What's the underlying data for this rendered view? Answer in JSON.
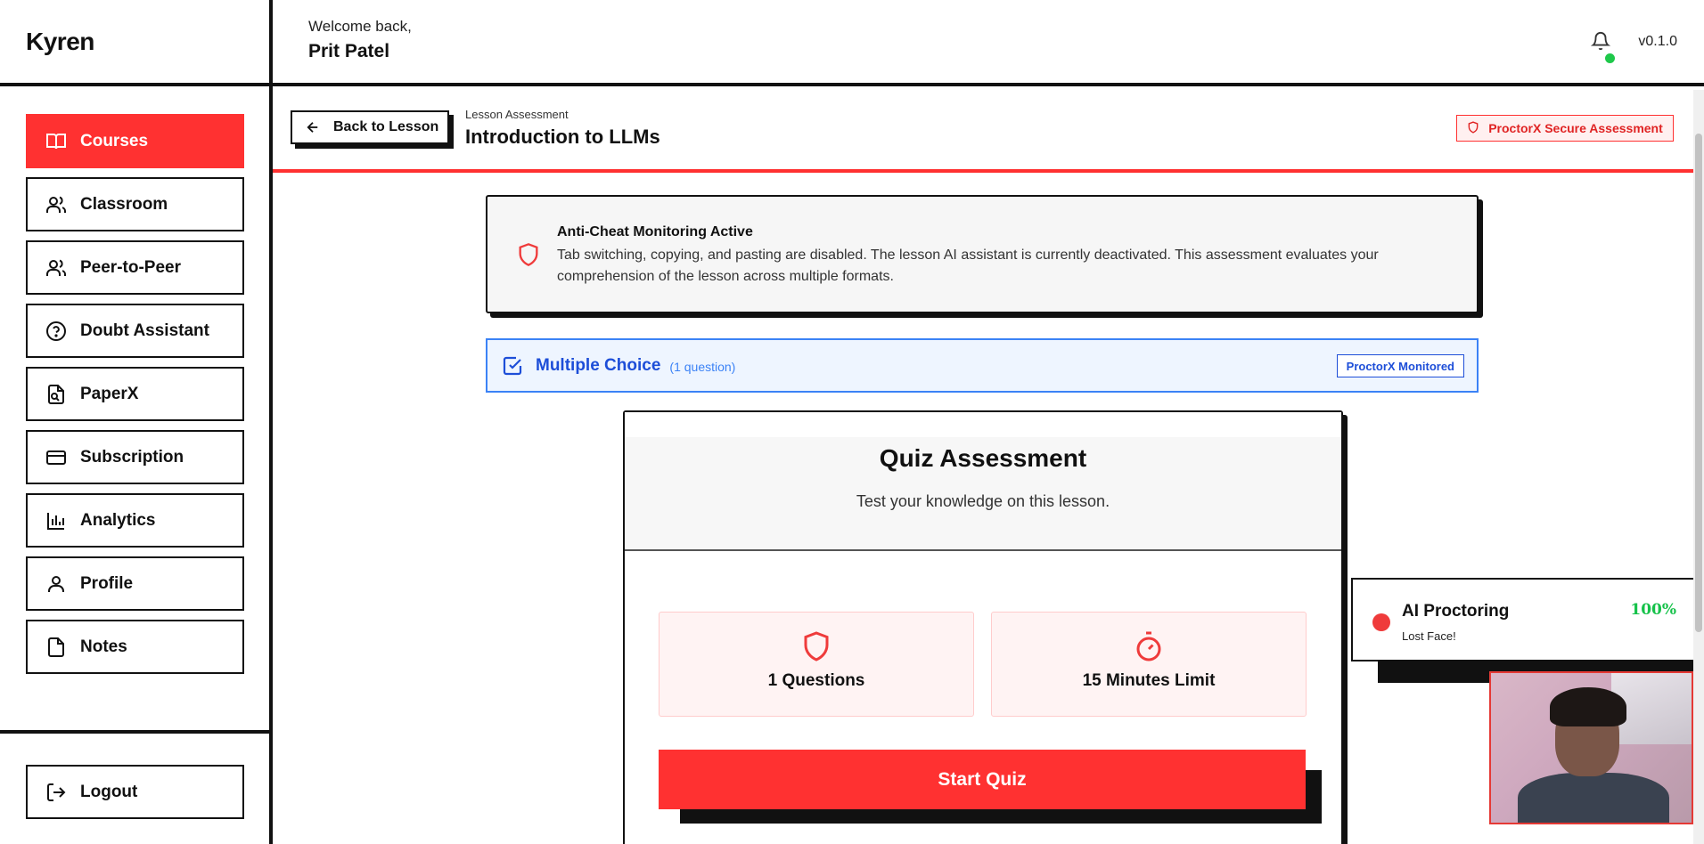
{
  "app": {
    "brand": "Kyren",
    "version": "v0.1.0"
  },
  "header": {
    "welcome": "Welcome back,",
    "user_name": "Prit Patel"
  },
  "sidebar": {
    "items": [
      {
        "label": "Courses",
        "icon": "book-open-icon",
        "active": true
      },
      {
        "label": "Classroom",
        "icon": "users-icon",
        "active": false
      },
      {
        "label": "Peer-to-Peer",
        "icon": "users-icon",
        "active": false
      },
      {
        "label": "Doubt Assistant",
        "icon": "help-circle-icon",
        "active": false
      },
      {
        "label": "PaperX",
        "icon": "file-search-icon",
        "active": false
      },
      {
        "label": "Subscription",
        "icon": "credit-card-icon",
        "active": false
      },
      {
        "label": "Analytics",
        "icon": "bar-chart-icon",
        "active": false
      },
      {
        "label": "Profile",
        "icon": "user-icon",
        "active": false
      },
      {
        "label": "Notes",
        "icon": "file-icon",
        "active": false
      }
    ],
    "logout_label": "Logout"
  },
  "lesson": {
    "back_label": "Back to Lesson",
    "kicker": "Lesson Assessment",
    "title": "Introduction to LLMs",
    "secure_badge": "ProctorX Secure Assessment"
  },
  "alert": {
    "title": "Anti-Cheat Monitoring Active",
    "text": "Tab switching, copying, and pasting are disabled. The lesson AI assistant is currently deactivated. This assessment evaluates your comprehension of the lesson across multiple formats."
  },
  "section": {
    "title": "Multiple Choice",
    "count": "(1 question)",
    "badge": "ProctorX Monitored"
  },
  "quiz": {
    "title": "Quiz Assessment",
    "subtitle": "Test your knowledge on this lesson.",
    "questions_label": "1 Questions",
    "time_label": "15 Minutes Limit",
    "start_label": "Start Quiz"
  },
  "proctoring": {
    "title": "AI Proctoring",
    "status": "Lost Face!",
    "score": "100%"
  },
  "colors": {
    "accent": "#ff3131",
    "info_blue": "#1d4ed8",
    "success_green": "#16c24a"
  }
}
